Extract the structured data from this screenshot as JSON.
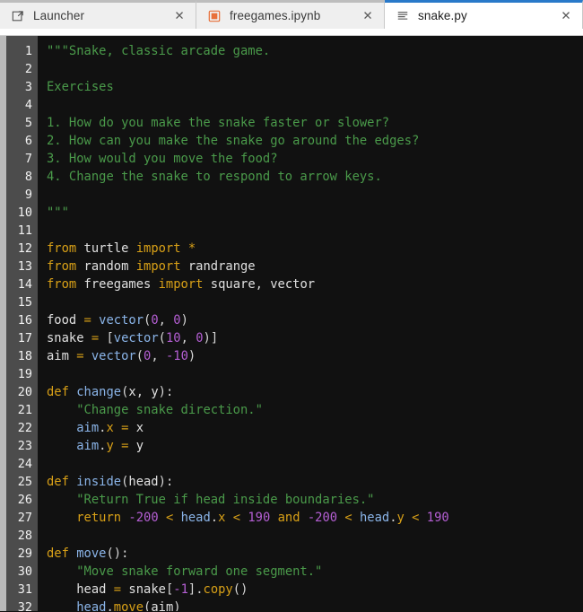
{
  "window": {
    "background": "#111111",
    "accent": "#2979c9"
  },
  "tabbar": {
    "tabs": [
      {
        "label": "Launcher",
        "icon": "launcher-icon",
        "close_glyph": "✕",
        "active": false
      },
      {
        "label": "freegames.ipynb",
        "icon": "notebook-icon",
        "close_glyph": "✕",
        "active": false
      },
      {
        "label": "snake.py",
        "icon": "text-file-icon",
        "close_glyph": "✕",
        "active": true
      }
    ]
  },
  "editor": {
    "filename": "snake.py",
    "language": "Python",
    "first_line": 1,
    "last_visible_line": 32,
    "line_numbers": [
      "1",
      "2",
      "3",
      "4",
      "5",
      "6",
      "7",
      "8",
      "9",
      "10",
      "11",
      "12",
      "13",
      "14",
      "15",
      "16",
      "17",
      "18",
      "19",
      "20",
      "21",
      "22",
      "23",
      "24",
      "25",
      "26",
      "27",
      "28",
      "29",
      "30",
      "31",
      "32"
    ],
    "lines": [
      "\"\"\"Snake, classic arcade game.",
      "",
      "Exercises",
      "",
      "1. How do you make the snake faster or slower?",
      "2. How can you make the snake go around the edges?",
      "3. How would you move the food?",
      "4. Change the snake to respond to arrow keys.",
      "",
      "\"\"\"",
      "",
      "from turtle import *",
      "from random import randrange",
      "from freegames import square, vector",
      "",
      "food = vector(0, 0)",
      "snake = [vector(10, 0)]",
      "aim = vector(0, -10)",
      "",
      "def change(x, y):",
      "    \"Change snake direction.\"",
      "    aim.x = x",
      "    aim.y = y",
      "",
      "def inside(head):",
      "    \"Return True if head inside boundaries.\"",
      "    return -200 < head.x < 190 and -200 < head.y < 190",
      "",
      "def move():",
      "    \"Move snake forward one segment.\"",
      "    head = snake[-1].copy()",
      "    head.move(aim)"
    ],
    "colors": {
      "background": "#111111",
      "gutter_background": "#4c4c4c",
      "gutter_text": "#f2f2f2",
      "string": "#4a9a4a",
      "keyword": "#d8a017",
      "number": "#b55fd4",
      "function": "#8ab4e8",
      "default_text": "#d6d6d6"
    }
  }
}
